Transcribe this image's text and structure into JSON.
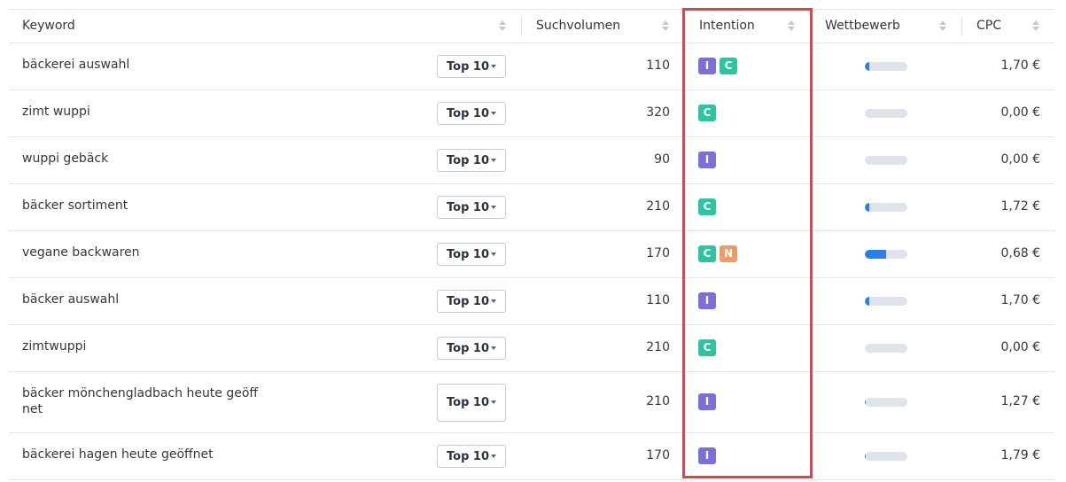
{
  "columns": {
    "keyword": "Keyword",
    "volume": "Suchvolumen",
    "intent": "Intention",
    "competition": "Wettbewerb",
    "cpc": "CPC"
  },
  "colors": {
    "intent_I": "#7b6fd8",
    "intent_C": "#2ec4a0",
    "intent_N": "#f09a64",
    "competition_fill": "#2b7de9",
    "highlight_border": "#d0494a"
  },
  "rows": [
    {
      "keyword": "bäckerei auswahl",
      "position": "Top 10",
      "volume": "110",
      "intents": [
        "I",
        "C"
      ],
      "competition": 0.1,
      "cpc": "1,70 €"
    },
    {
      "keyword": "zimt wuppi",
      "position": "Top 10",
      "volume": "320",
      "intents": [
        "C"
      ],
      "competition": 0.0,
      "cpc": "0,00 €"
    },
    {
      "keyword": "wuppi gebäck",
      "position": "Top 10",
      "volume": "90",
      "intents": [
        "I"
      ],
      "competition": 0.0,
      "cpc": "0,00 €"
    },
    {
      "keyword": "bäcker sortiment",
      "position": "Top 10",
      "volume": "210",
      "intents": [
        "C"
      ],
      "competition": 0.1,
      "cpc": "1,72 €"
    },
    {
      "keyword": "vegane backwaren",
      "position": "Top 10",
      "volume": "170",
      "intents": [
        "C",
        "N"
      ],
      "competition": 0.5,
      "cpc": "0,68 €"
    },
    {
      "keyword": "bäcker auswahl",
      "position": "Top 10",
      "volume": "110",
      "intents": [
        "I"
      ],
      "competition": 0.1,
      "cpc": "1,70 €"
    },
    {
      "keyword": "zimtwuppi",
      "position": "Top 10",
      "volume": "210",
      "intents": [
        "C"
      ],
      "competition": 0.0,
      "cpc": "0,00 €"
    },
    {
      "keyword": "bäcker mönchengladbach heute geöffnet",
      "position": "Top 10",
      "volume": "210",
      "intents": [
        "I"
      ],
      "competition": 0.03,
      "cpc": "1,27 €"
    },
    {
      "keyword": "bäckerei hagen heute geöffnet",
      "position": "Top 10",
      "volume": "170",
      "intents": [
        "I"
      ],
      "competition": 0.03,
      "cpc": "1,79 €"
    }
  ]
}
